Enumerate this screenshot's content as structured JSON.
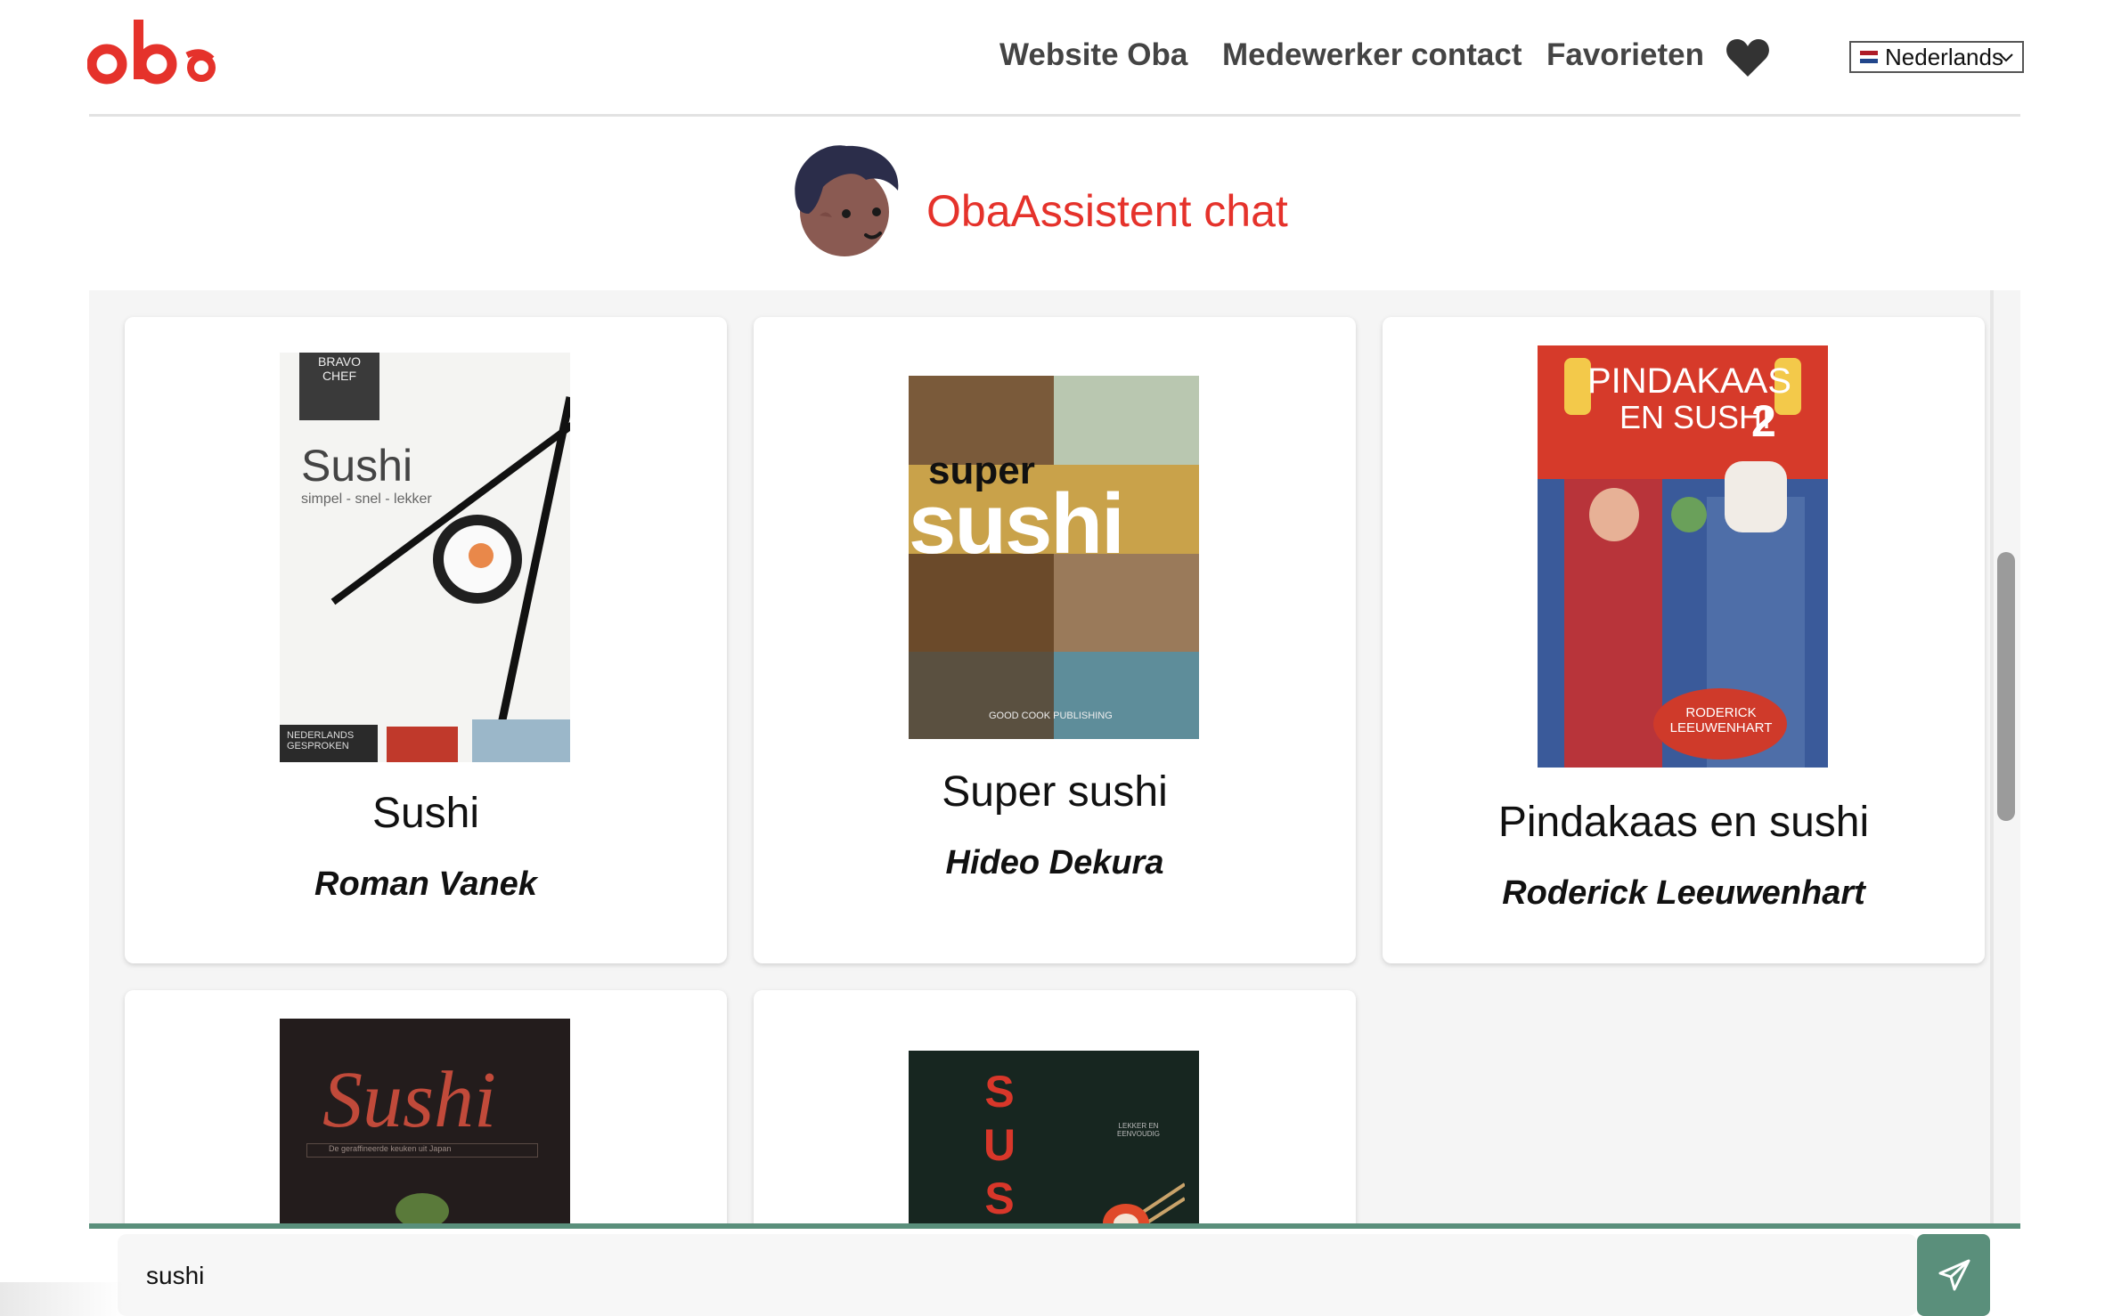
{
  "brand": {
    "logo_text": "oba",
    "accent_color": "#e5322b"
  },
  "nav": {
    "links": [
      "Website Oba",
      "Medewerker contact",
      "Favorieten"
    ],
    "favorites_icon": "heart-icon",
    "language": {
      "selected": "Nederlands",
      "flag": "netherlands-flag-icon"
    }
  },
  "chat": {
    "title": "ObaAssistent chat",
    "avatar": "assistant-avatar",
    "input_value": "sushi",
    "send_icon": "paper-plane-icon",
    "send_color": "#5a8f7b"
  },
  "results": [
    {
      "title": "Sushi",
      "author": "Roman Vanek",
      "cover": {
        "top": "BRAVO CHEF",
        "title": "Sushi",
        "subtitle": "simpel - snel - lekker",
        "badge": "NEDERLANDS GESPROKEN"
      }
    },
    {
      "title": "Super sushi",
      "author": "Hideo Dekura",
      "cover": {
        "line1": "super",
        "line2": "sushi",
        "publisher": "GOOD COOK PUBLISHING"
      }
    },
    {
      "title": "Pindakaas en sushi",
      "author": "Roderick Leeuwenhart",
      "cover": {
        "line1": "PINDAKAAS",
        "line2": "EN SUSHI",
        "number": "2",
        "author": "RODERICK LEEUWENHART"
      }
    },
    {
      "title": "",
      "author": "",
      "cover": {
        "title": "Sushi",
        "subtitle": "De geraffineerde keuken uit Japan"
      }
    },
    {
      "title": "",
      "author": "",
      "cover": {
        "vertical": "SUS",
        "side": "LEKKER EN EENVOUDIG"
      }
    }
  ]
}
